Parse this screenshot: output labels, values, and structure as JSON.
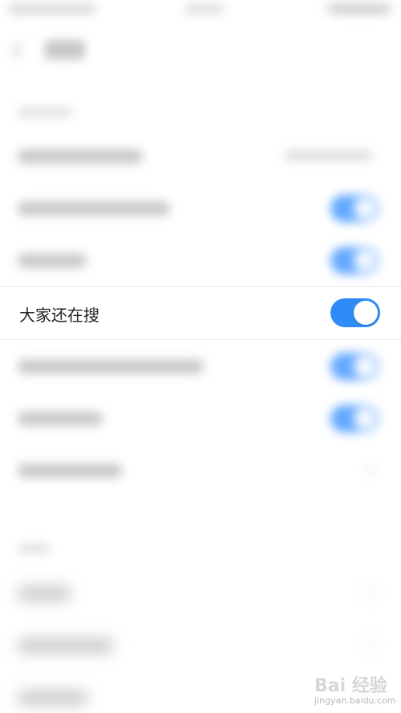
{
  "main": {
    "highlighted_row": {
      "label": "大家还在搜",
      "toggle_on": true
    }
  },
  "colors": {
    "accent": "#2f8cf6",
    "knob": "#ffffff",
    "background": "#ffffff"
  },
  "watermark": {
    "mark": "Bai 经验",
    "url": "jingyan.baidu.com"
  },
  "icons": {
    "back": "chevron-left-icon",
    "chevron": "chevron-right-icon",
    "paw": "baidu-paw-icon"
  }
}
